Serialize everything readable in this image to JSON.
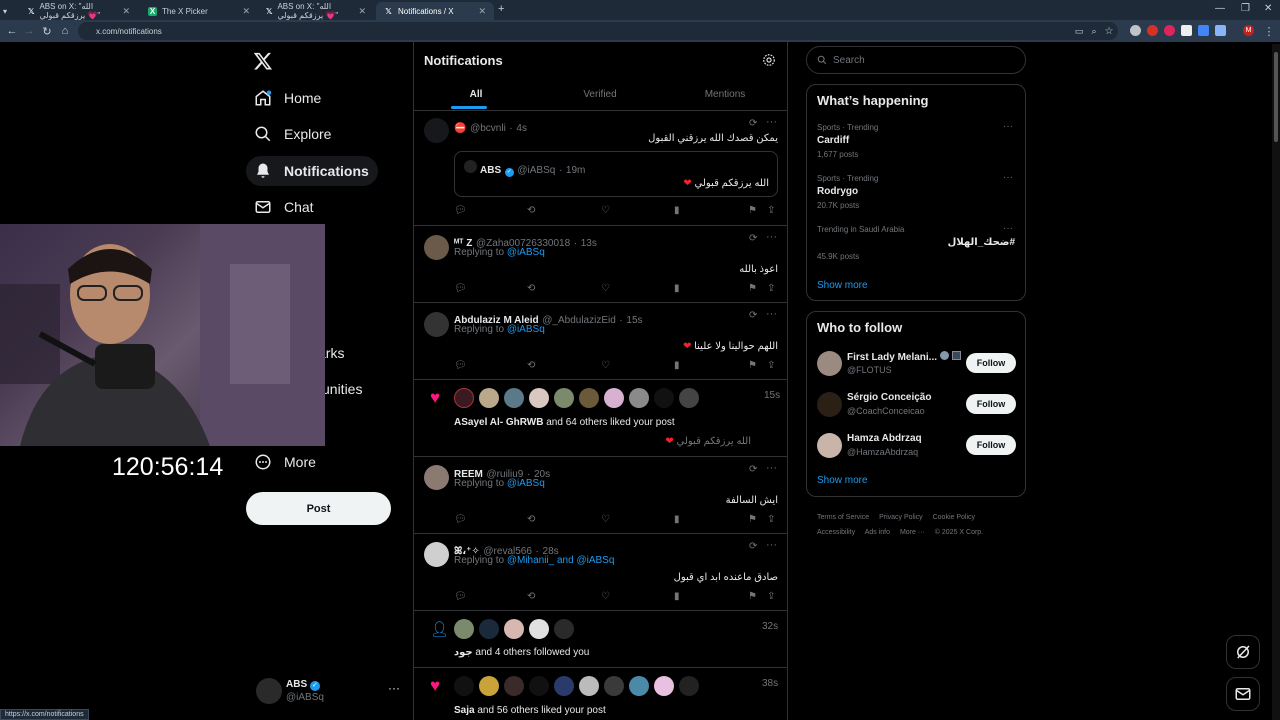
{
  "browser": {
    "tabs": [
      {
        "title": "ABS on X: \"الله يرزقكم قبولي 💗\"",
        "favicon": "X"
      },
      {
        "title": "The X Picker",
        "favicon": "X"
      },
      {
        "title": "ABS on X: \"الله يرزقكم قبولي 💗\"",
        "favicon": "X"
      },
      {
        "title": "Notifications / X",
        "favicon": "X"
      }
    ],
    "url": "x.com/notifications",
    "status_url": "https://x.com/notifications"
  },
  "nav": {
    "items": [
      {
        "label": "Home",
        "icon": "home-icon"
      },
      {
        "label": "Explore",
        "icon": "search-icon"
      },
      {
        "label": "Notifications",
        "icon": "bell-icon"
      },
      {
        "label": "Chat",
        "icon": "mail-icon"
      },
      {
        "label": "m",
        "icon": ""
      },
      {
        "label": "arks",
        "icon": ""
      },
      {
        "label": "unities",
        "icon": ""
      },
      {
        "label": "More",
        "icon": "more-icon"
      }
    ],
    "post_label": "Post",
    "account": {
      "name": "ABS",
      "handle": "@iABSq"
    }
  },
  "stream": {
    "timer": "120:56:14"
  },
  "main": {
    "title": "Notifications",
    "tabs": [
      "All",
      "Verified",
      "Mentions"
    ],
    "notifications": [
      {
        "name": "",
        "handle": "@bcvnli",
        "time": "4s",
        "text": "يمكن قصدك الله يرزقني القبول",
        "quote": {
          "name": "ABS",
          "handle": "@iABSq",
          "time": "19m",
          "text": "الله يرزقكم قبولي"
        }
      },
      {
        "name": "ᴹᵀ Z",
        "handle": "@Zaha00726330018",
        "time": "13s",
        "replying": "Replying to",
        "replying_to": "@iABSq",
        "text": "اعوذ بالله"
      },
      {
        "name": "Abdulaziz M Aleid",
        "handle": "@_AbdulazizEid",
        "time": "15s",
        "replying": "Replying to",
        "replying_to": "@iABSq",
        "text": "اللهم حوالينا ولا علينا"
      },
      {
        "like_names": "ASayel Al- GhRWB",
        "like_rest": "and 64 others liked your post",
        "time": "15s",
        "post": "الله يرزقكم قبولي"
      },
      {
        "name": "REEM",
        "handle": "@ruiliu9",
        "time": "20s",
        "replying": "Replying to",
        "replying_to": "@iABSq",
        "text": "ايش السالفة"
      },
      {
        "name": "ꕤ،⁺✧",
        "handle": "@reval566",
        "time": "28s",
        "replying": "Replying to",
        "replying_to": "@Mihanii_ and @iABSq",
        "text": "صادق ماعنده ابد اي قبول"
      },
      {
        "follow_names": "جود",
        "follow_rest": "and 4 others followed you",
        "time": "32s"
      },
      {
        "like_names": "Saja",
        "like_rest": "and 56 others liked your post",
        "time": "38s"
      }
    ]
  },
  "right": {
    "search_placeholder": "Search",
    "happening": {
      "title": "What’s happening",
      "trends": [
        {
          "context": "Sports · Trending",
          "name": "Cardiff",
          "posts": "1,677 posts"
        },
        {
          "context": "Sports · Trending",
          "name": "Rodrygo",
          "posts": "20.7K posts"
        },
        {
          "context": "Trending in Saudi Arabia",
          "name": "#ضحك_الهلال",
          "posts": "45.9K posts"
        }
      ],
      "show_more": "Show more"
    },
    "follow": {
      "title": "Who to follow",
      "users": [
        {
          "name": "First Lady Melani...",
          "handle": "@FLOTUS",
          "button": "Follow"
        },
        {
          "name": "Sérgio Conceição",
          "handle": "@CoachConceicao",
          "button": "Follow"
        },
        {
          "name": "Hamza Abdrzaq",
          "handle": "@HamzaAbdrzaq",
          "button": "Follow"
        }
      ],
      "show_more": "Show more"
    },
    "footer": [
      "Terms of Service",
      "Privacy Policy",
      "Cookie Policy",
      "Accessibility",
      "Ads info",
      "More ···",
      "© 2025 X Corp."
    ]
  },
  "colors": {
    "accent": "#1d9bf0",
    "like": "#f91880",
    "border": "#2f3336",
    "muted": "#71767b"
  }
}
